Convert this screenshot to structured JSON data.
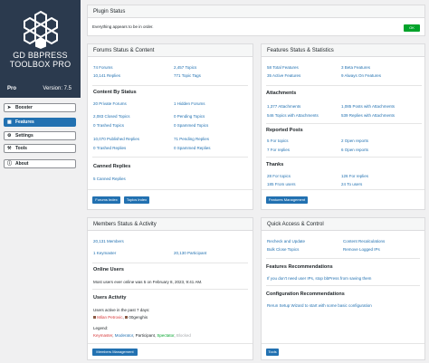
{
  "sidebar": {
    "logo_line1": "GD BBPRESS",
    "logo_line2": "TOOLBOX PRO",
    "edition": "Pro",
    "version": "Version: 7.5",
    "nav": [
      {
        "label": "Booster",
        "icon": "rocket-icon",
        "active": false
      },
      {
        "label": "Features",
        "icon": "grid-icon",
        "active": true
      },
      {
        "label": "Settings",
        "icon": "gear-icon",
        "active": false
      },
      {
        "label": "Tools",
        "icon": "wrench-icon",
        "active": false
      },
      {
        "label": "About",
        "icon": "info-icon",
        "active": false
      }
    ]
  },
  "plugin_status": {
    "title": "Plugin Status",
    "message": "Everything appears to be in order.",
    "badge": "OK"
  },
  "forums": {
    "title": "Forums Status & Content",
    "stats": [
      {
        "value": "74",
        "label": "Forums"
      },
      {
        "value": "2,457",
        "label": "Topics"
      },
      {
        "value": "10,141",
        "label": "Replies"
      },
      {
        "value": "771",
        "label": "Topic Tags"
      }
    ],
    "content_heading": "Content By Status",
    "content": [
      {
        "value": "20",
        "label": "Private Forums"
      },
      {
        "value": "1",
        "label": "Hidden Forums"
      },
      {
        "value": "2,083",
        "label": "Closed Topics"
      },
      {
        "value": "0",
        "label": "Pending Topics"
      },
      {
        "value": "0",
        "label": "Trashed Topics"
      },
      {
        "value": "0",
        "label": "Spammed Topics"
      },
      {
        "value": "10,070",
        "label": "Published Replies"
      },
      {
        "value": "71",
        "label": "Pending Replies"
      },
      {
        "value": "0",
        "label": "Trashed Replies"
      },
      {
        "value": "0",
        "label": "Spammed Replies"
      }
    ],
    "canned_heading": "Canned Replies",
    "canned": {
      "value": "5",
      "label": "Canned Replies"
    },
    "buttons": [
      "Forums Index",
      "Topics Index"
    ]
  },
  "features": {
    "title": "Features Status & Statistics",
    "stats": [
      {
        "value": "58",
        "label": "Total Features"
      },
      {
        "value": "3",
        "label": "Beta Features"
      },
      {
        "value": "35",
        "label": "Active Features"
      },
      {
        "value": "9",
        "label": "Always On Features"
      }
    ],
    "attachments_heading": "Attachments",
    "attachments": [
      {
        "value": "1,377",
        "label": "Attachments"
      },
      {
        "value": "1,085",
        "label": "Posts with Attachments"
      },
      {
        "value": "546",
        "label": "Topics with Attachments"
      },
      {
        "value": "539",
        "label": "Replies with Attachments"
      }
    ],
    "reported_heading": "Reported Posts",
    "reported": [
      {
        "value": "5",
        "label": "For topics"
      },
      {
        "value": "2",
        "label": "Open reports"
      },
      {
        "value": "7",
        "label": "For replies"
      },
      {
        "value": "6",
        "label": "Open reports"
      }
    ],
    "thanks_heading": "Thanks",
    "thanks": [
      {
        "value": "28",
        "label": "For topics"
      },
      {
        "value": "126",
        "label": "For replies"
      },
      {
        "value": "185",
        "label": "From users"
      },
      {
        "value": "24",
        "label": "To users"
      }
    ],
    "button": "Features Management"
  },
  "members": {
    "title": "Members Status & Activity",
    "members": {
      "value": "20,131",
      "label": "Members"
    },
    "keymaster": {
      "value": "1",
      "label": "Keymaster"
    },
    "participant": {
      "value": "20,130",
      "label": "Participant"
    },
    "online_heading": "Online Users",
    "online_text": "Most users ever online was 5 on February 8, 2023, 9:41 AM.",
    "activity_heading": "Users Activity",
    "activity_text": "Users active in the past 7 days:",
    "active_users": [
      "Milan Petrovic",
      "00genghis"
    ],
    "legend_label": "Legend:",
    "legend": [
      {
        "label": "Keymaster",
        "color": "#d63638"
      },
      {
        "label": "Moderator",
        "color": "#2271b1"
      },
      {
        "label": "Participant",
        "color": "#1d2327"
      },
      {
        "label": "Spectator",
        "color": "#00a32a"
      },
      {
        "label": "Blocked",
        "color": "#a7aaad"
      }
    ],
    "button": "Members Management"
  },
  "quick": {
    "title": "Quick Access & Control",
    "links": [
      "Recheck and Update",
      "Content Recalculations",
      "Bulk Close Topics",
      "Remove Logged IPs"
    ],
    "feat_rec_heading": "Features Recommendations",
    "feat_rec": "If you don't need user IPs, stop bbPress from saving them",
    "config_heading": "Configuration Recommendations",
    "config": "Rerun Setup Wizard to start with some basic configuration",
    "button": "Tools"
  }
}
